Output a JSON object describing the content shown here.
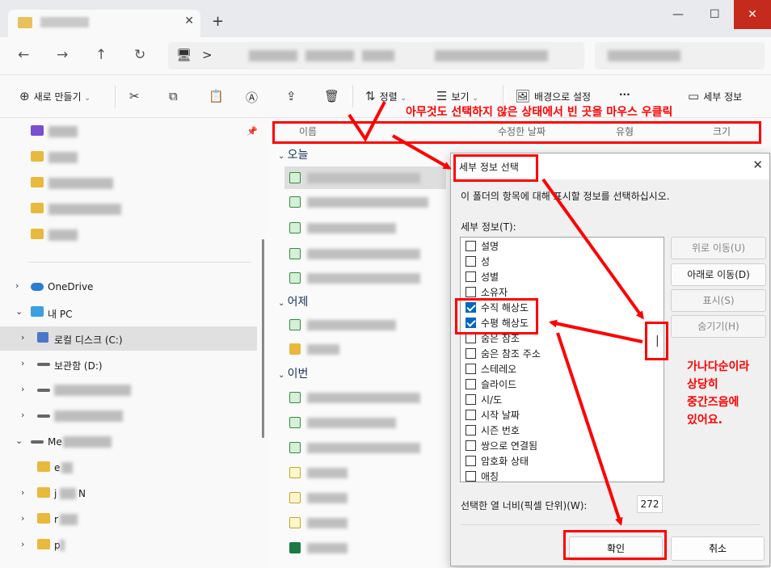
{
  "colors": {
    "annotation": "#ff0000",
    "checkbox_checked": "#0067c0",
    "folder": "#e8b93c"
  },
  "window": {
    "close_glyph": "✕",
    "minimize_glyph": "—",
    "maximize_glyph": "☐",
    "tab_close_glyph": "✕",
    "tab_add_glyph": "+"
  },
  "nav": {
    "back": "←",
    "forward": "→",
    "up": "↑",
    "refresh": "↻",
    "chevron": ">",
    "dot": "·"
  },
  "toolbar": {
    "new_label": "새로 만들기",
    "sort_label": "정렬",
    "view_label": "보기",
    "background_label": "배경으로 설정",
    "more_label": "···",
    "details_label": "세부 정보"
  },
  "sidebar": {
    "onedrive": "OneDrive",
    "this_pc": "내 PC",
    "local_disk": "로컬 디스크 (C:)",
    "storage": "보관함 (D:)",
    "me_prefix": "Me",
    "sub_e": "e",
    "sub_j": "j",
    "sub_n": "N",
    "sub_r": "r",
    "sub_p": "p"
  },
  "columns": {
    "name": "이름",
    "modified": "수정한 날짜",
    "type": "유형",
    "size": "크기"
  },
  "groups": {
    "today": "오늘",
    "yesterday": "어제",
    "this_week": "이번"
  },
  "dialog": {
    "title": "세부 정보 선택",
    "description": "이 폴더의 항목에 대해 표시할 정보를 선택하십시오.",
    "list_label": "세부 정보(T):",
    "items": [
      {
        "label": "설명",
        "checked": false
      },
      {
        "label": "성",
        "checked": false
      },
      {
        "label": "성별",
        "checked": false
      },
      {
        "label": "소유자",
        "checked": false
      },
      {
        "label": "수직 해상도",
        "checked": true
      },
      {
        "label": "수평 해상도",
        "checked": true
      },
      {
        "label": "숨은 참조",
        "checked": false
      },
      {
        "label": "숨은 참조 주소",
        "checked": false
      },
      {
        "label": "스테레오",
        "checked": false
      },
      {
        "label": "슬라이드",
        "checked": false
      },
      {
        "label": "시/도",
        "checked": false
      },
      {
        "label": "시작 날짜",
        "checked": false
      },
      {
        "label": "시즌 번호",
        "checked": false
      },
      {
        "label": "쌍으로 연결됨",
        "checked": false
      },
      {
        "label": "암호화 상태",
        "checked": false
      },
      {
        "label": "애칭",
        "checked": false
      }
    ],
    "btn_up": "위로 이동(U)",
    "btn_down": "아래로 이동(D)",
    "btn_show": "표시(S)",
    "btn_hide": "숨기기(H)",
    "width_label": "선택한 열 너비(픽셀 단위)(W):",
    "width_value": "272",
    "ok": "확인",
    "cancel": "취소"
  },
  "annotations": {
    "top_note": "아무것도 선택하지 않은 상태에서 빈 곳을 마우스 우클릭",
    "side_note": [
      "가나다순이라",
      "상당히",
      "중간즈음에",
      "있어요."
    ],
    "scroll_mark": "|"
  }
}
